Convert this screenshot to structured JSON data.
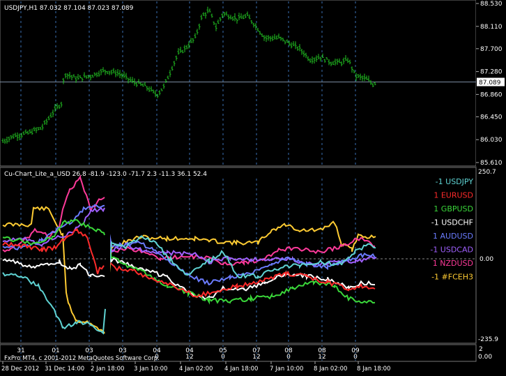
{
  "main_chart": {
    "title": "USDJPY,H1  87.032 87.104 87.023 87.089",
    "price_tag": "87.089",
    "price_levels": [
      "88.530",
      "88.110",
      "87.700",
      "87.280",
      "86.860",
      "86.450",
      "86.030",
      "85.610"
    ],
    "current_price": 87.089,
    "ylim": [
      85.61,
      88.53
    ]
  },
  "indicator": {
    "title": "Cu-Chart_Lite_a_USD 26.8 -81.9 -123.0 -71.7 2.3 -11.3 36.1 52.4",
    "axis_labels": [
      "250.7",
      "0.00",
      "-235.9"
    ],
    "legend": [
      {
        "text": "-1 USDJPY",
        "color": "#5fd3d3"
      },
      {
        "text": "1 EURUSD",
        "color": "#ff2b2b"
      },
      {
        "text": "1 GBPUSD",
        "color": "#3ad73a"
      },
      {
        "text": "-1 USDCHF",
        "color": "#ffffff"
      },
      {
        "text": "1 AUDUSD",
        "color": "#6b7cff"
      },
      {
        "text": "-1 USDCAD",
        "color": "#a060ff"
      },
      {
        "text": "1 NZDUSD",
        "color": "#ff3a9a"
      },
      {
        "text": "-1 #FCEH3",
        "color": "#ffcc33"
      }
    ]
  },
  "sub_panel": {
    "day_labels": [
      "31",
      "01",
      "03",
      "03",
      "04",
      "04",
      "05",
      "07",
      "08",
      "08",
      "09"
    ],
    "hour_labels": [
      "",
      "",
      "",
      "",
      "0",
      "12",
      "0",
      "12",
      "0",
      "12",
      "0"
    ],
    "axis_labels": [
      "2",
      "0.00"
    ],
    "copyright": "FxPro MT4, c 2001-2012 MetaQuotes Software Corp."
  },
  "time_axis": [
    "28 Dec 2012",
    "31 Dec 14:00",
    "2 Jan 18:00",
    "3 Jan 10:00",
    "4 Jan 02:00",
    "4 Jan 18:00",
    "7 Jan 10:00",
    "8 Jan 02:00",
    "8 Jan 18:00"
  ],
  "colors": {
    "candles": "#22c422",
    "grid": "#3a6fb5",
    "background": "#000000"
  }
}
